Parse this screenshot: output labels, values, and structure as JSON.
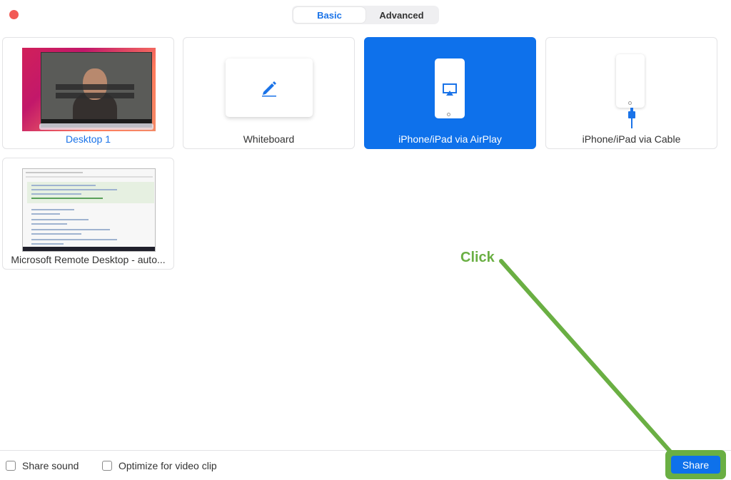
{
  "window": {
    "close_icon": "close-dot-icon"
  },
  "tabs": [
    {
      "label": "Basic",
      "active": true
    },
    {
      "label": "Advanced",
      "active": false
    }
  ],
  "share_options": [
    {
      "label": "Desktop 1",
      "icon": "desktop-thumbnail",
      "selected": false
    },
    {
      "label": "Whiteboard",
      "icon": "pencil-icon",
      "selected": false
    },
    {
      "label": "iPhone/iPad via AirPlay",
      "icon": "airplay-icon",
      "selected": true
    },
    {
      "label": "iPhone/iPad via Cable",
      "icon": "cable-icon",
      "selected": false
    },
    {
      "label": "Microsoft Remote Desktop - auto...",
      "icon": "window-thumbnail",
      "selected": false
    }
  ],
  "footer": {
    "share_sound_label": "Share sound",
    "share_sound_checked": false,
    "optimize_label": "Optimize for video clip",
    "optimize_checked": false,
    "share_button_label": "Share"
  },
  "annotation": {
    "text": "Click",
    "color": "#6aaf43"
  },
  "colors": {
    "accent": "#0e71eb",
    "link": "#1a73e8",
    "close": "#f25a55"
  }
}
